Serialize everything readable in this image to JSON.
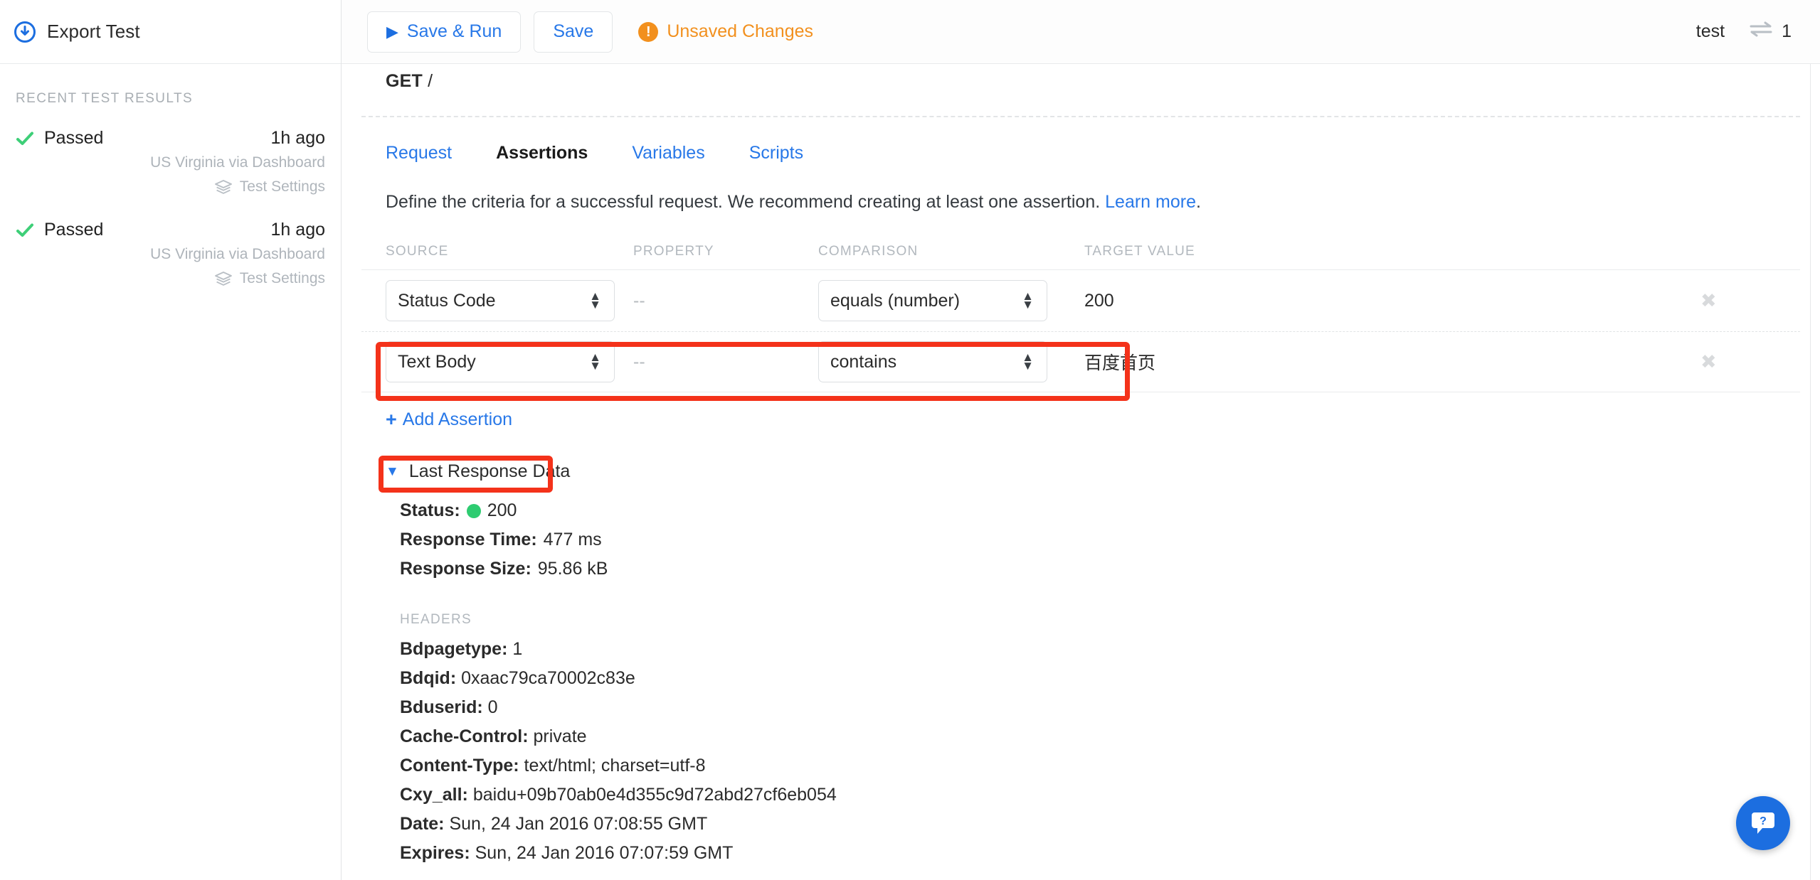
{
  "sidebar": {
    "export": {
      "label": "Export Test",
      "icon": "download-circle-icon"
    },
    "recent_title": "RECENT TEST RESULTS",
    "results": [
      {
        "status": "Passed",
        "time": "1h ago",
        "location": "US Virginia via Dashboard",
        "settings": "Test Settings"
      },
      {
        "status": "Passed",
        "time": "1h ago",
        "location": "US Virginia via Dashboard",
        "settings": "Test Settings"
      }
    ]
  },
  "topbar": {
    "save_run_label": "Save & Run",
    "save_label": "Save",
    "unsaved_label": "Unsaved Changes",
    "account": "test",
    "connections": "1",
    "accent_blue": "#2878e8",
    "warn_orange": "#f2901e"
  },
  "request": {
    "method": "GET",
    "path": "/"
  },
  "tabs": [
    {
      "label": "Request",
      "active": false
    },
    {
      "label": "Assertions",
      "active": true
    },
    {
      "label": "Variables",
      "active": false
    },
    {
      "label": "Scripts",
      "active": false
    }
  ],
  "assertions": {
    "description": "Define the criteria for a successful request. We recommend creating at least one assertion.",
    "learn_more": "Learn more",
    "description_end": ".",
    "columns": [
      "SOURCE",
      "PROPERTY",
      "COMPARISON",
      "TARGET VALUE"
    ],
    "rows": [
      {
        "source": "Status Code",
        "property": "--",
        "comparison": "equals (number)",
        "target": "200",
        "delete": "✖"
      },
      {
        "source": "Text Body",
        "property": "--",
        "comparison": "contains",
        "target": "百度首页",
        "delete": "✖"
      }
    ],
    "add_label": "Add Assertion",
    "add_plus": "+"
  },
  "last_response": {
    "toggle_label": "Last Response Data",
    "caret": "▼",
    "status_label": "Status:",
    "status_value": "200",
    "status_color": "#2ecc71",
    "response_time_label": "Response Time:",
    "response_time_value": "477 ms",
    "response_size_label": "Response Size:",
    "response_size_value": "95.86 kB",
    "headers_title": "HEADERS",
    "headers": [
      {
        "name": "Bdpagetype:",
        "value": "1"
      },
      {
        "name": "Bdqid:",
        "value": "0xaac79ca70002c83e"
      },
      {
        "name": "Bduserid:",
        "value": "0"
      },
      {
        "name": "Cache-Control:",
        "value": "private"
      },
      {
        "name": "Content-Type:",
        "value": "text/html; charset=utf-8"
      },
      {
        "name": "Cxy_all:",
        "value": "baidu+09b70ab0e4d355c9d72abd27cf6eb054"
      },
      {
        "name": "Date:",
        "value": "Sun, 24 Jan 2016 07:08:55 GMT"
      },
      {
        "name": "Expires:",
        "value": "Sun, 24 Jan 2016 07:07:59 GMT"
      }
    ]
  },
  "help": {
    "icon": "help-chat-icon",
    "glyph": "?"
  },
  "annotations": {
    "highlight_color": "#f4321a",
    "boxes": [
      "assertion-row-text-body",
      "last-response-data-toggle"
    ]
  }
}
